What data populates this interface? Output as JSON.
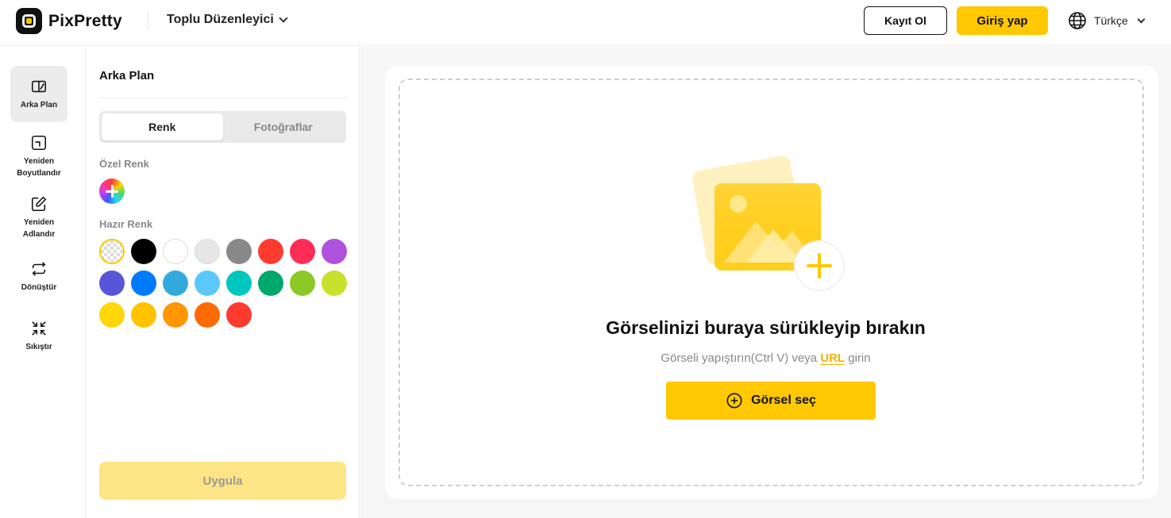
{
  "header": {
    "logo_text": "PixPretty",
    "bulk_editor_label": "Toplu Düzenleyici",
    "signup_label": "Kayıt Ol",
    "login_label": "Giriş yap",
    "language_label": "Türkçe"
  },
  "rail": {
    "items": [
      {
        "label": "Arka Plan",
        "icon": "background-icon",
        "active": true
      },
      {
        "label": "Yeniden Boyutlandır",
        "icon": "resize-icon",
        "active": false
      },
      {
        "label": "Yeniden Adlandır",
        "icon": "rename-icon",
        "active": false
      },
      {
        "label": "Dönüştür",
        "icon": "convert-icon",
        "active": false
      },
      {
        "label": "Sıkıştır",
        "icon": "compress-icon",
        "active": false
      }
    ]
  },
  "panel": {
    "title": "Arka Plan",
    "tabs": [
      "Renk",
      "Fotoğraflar"
    ],
    "selected_tab": "Renk",
    "custom_color_label": "Özel Renk",
    "preset_color_label": "Hazır Renk",
    "preset_colors": [
      "transparent",
      "#000000",
      "#ffffff",
      "#e6e6e6",
      "#888888",
      "#ff3b30",
      "#ff2d55",
      "#af52de",
      "#5856d6",
      "#007aff",
      "#34aadc",
      "#5ac8fa",
      "#00c7be",
      "#00a86b",
      "#8ac926",
      "#c7e12d",
      "#ffd60a",
      "#ffc300",
      "#ff9500",
      "#ff6b00",
      "#ff3b30"
    ],
    "selected_color": "transparent",
    "apply_label": "Uygula"
  },
  "dropzone": {
    "title": "Görselinizi buraya sürükleyip bırakın",
    "subtitle_prefix": "Görseli yapıştırın(Ctrl V) veya",
    "subtitle_link": "URL",
    "subtitle_suffix": "girin",
    "select_button_label": "Görsel seç"
  },
  "colors": {
    "accent": "#ffc800",
    "apply_disabled": "#fde585"
  }
}
